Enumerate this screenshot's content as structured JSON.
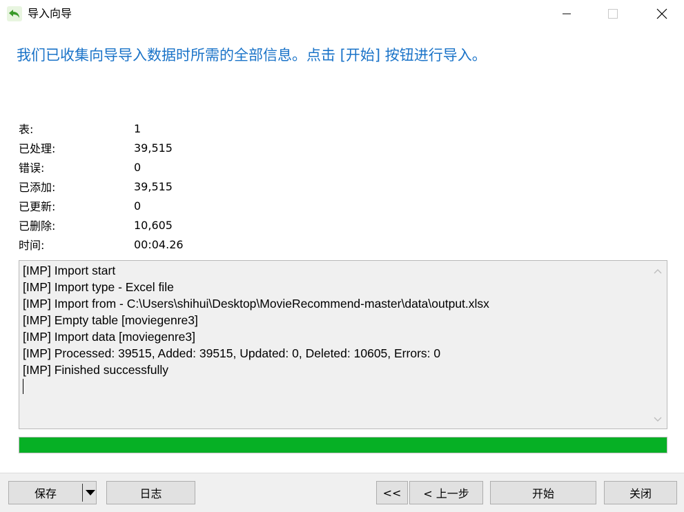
{
  "window": {
    "title": "导入向导"
  },
  "headline": "我们已收集向导导入数据时所需的全部信息。点击 [开始] 按钮进行导入。",
  "stats": [
    {
      "label": "表:",
      "value": "1"
    },
    {
      "label": "已处理:",
      "value": "39,515"
    },
    {
      "label": "错误:",
      "value": "0"
    },
    {
      "label": "已添加:",
      "value": "39,515"
    },
    {
      "label": "已更新:",
      "value": "0"
    },
    {
      "label": "已删除:",
      "value": "10,605"
    },
    {
      "label": "时间:",
      "value": "00:04.26"
    }
  ],
  "log": {
    "lines": [
      "[IMP] Import start",
      "[IMP] Import type - Excel file",
      "[IMP] Import from - C:\\Users\\shihui\\Desktop\\MovieRecommend-master\\data\\output.xlsx",
      "[IMP] Empty table [moviegenre3]",
      "[IMP] Import data [moviegenre3]",
      "[IMP] Processed: 39515, Added: 39515, Updated: 0, Deleted: 10605, Errors: 0",
      "[IMP] Finished successfully"
    ]
  },
  "progress": {
    "fraction": 1.0,
    "color": "#06b025"
  },
  "footer": {
    "save_label": "保存",
    "log_label": "日志",
    "first_label": "<<",
    "back_label": "< 上一步",
    "start_label": "开始",
    "close_label": "关闭"
  },
  "colors": {
    "headline": "#1a73c8",
    "progress": "#06b025"
  },
  "icons": [
    "back-arrow-app-icon",
    "minimize-icon",
    "maximize-icon",
    "close-icon",
    "scroll-up-icon",
    "scroll-down-icon",
    "dropdown-arrow-icon"
  ]
}
